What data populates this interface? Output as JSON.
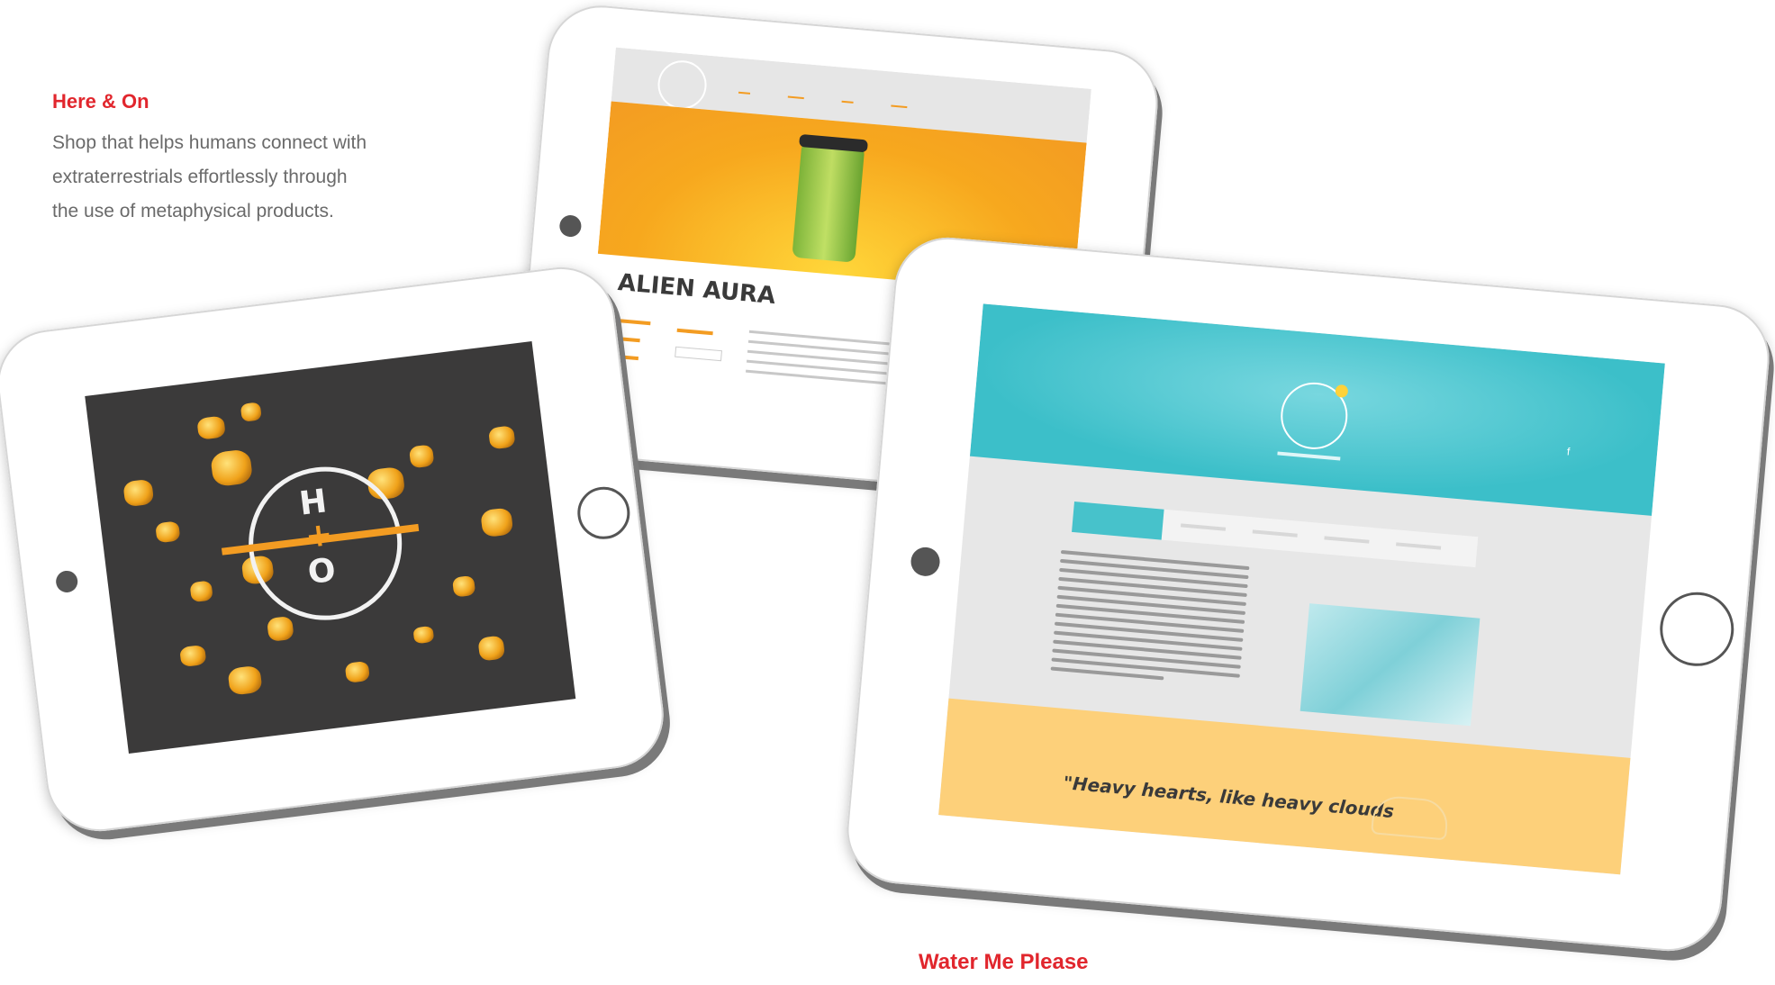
{
  "projects": [
    {
      "title": "Here & On",
      "description_lines": [
        "Shop that helps humans connect with",
        "extraterrestrials effortlessly through",
        "the use of metaphysical products."
      ]
    },
    {
      "title": "Water Me Please"
    }
  ],
  "here_on_logo": {
    "top_letter": "H",
    "bottom_letter": "O",
    "cross": "+"
  },
  "product_page": {
    "product_name": "ALIEN AURA"
  },
  "water_me_page": {
    "quote": "\"Heavy hearts, like heavy clouds"
  },
  "colors": {
    "accent_red": "#e1262d",
    "orange": "#f39c22",
    "teal": "#3cbfc9",
    "yellow": "#fdd07a"
  }
}
